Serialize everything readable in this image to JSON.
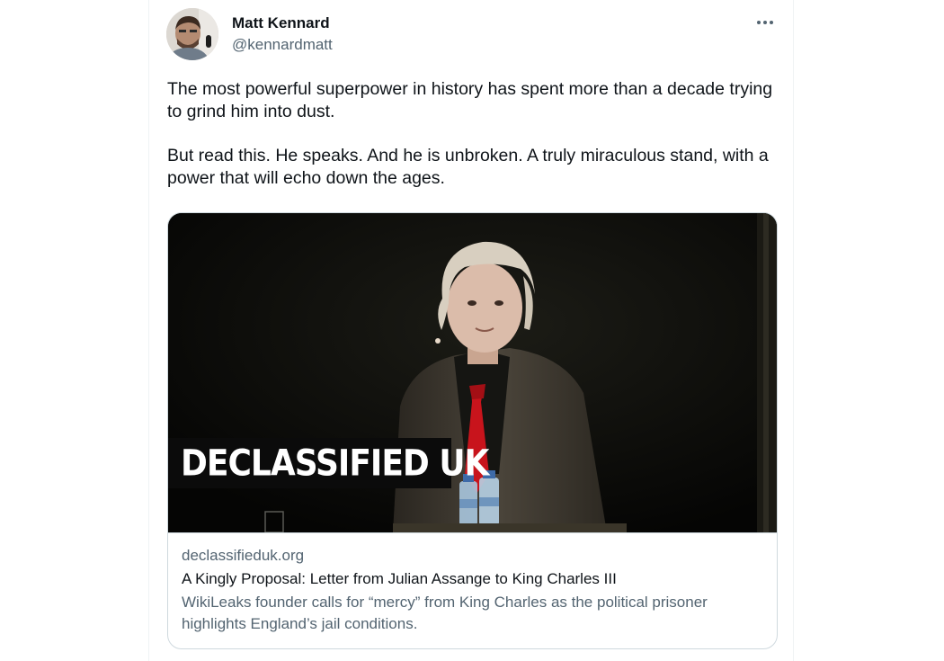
{
  "author": {
    "name": "Matt Kennard",
    "handle": "@kennardmatt"
  },
  "more_icon": "more-horizontal-icon",
  "tweet": {
    "paragraphs": [
      "The most powerful superpower in history has spent more than a decade trying to grind him into dust.",
      "But read this. He speaks. And he is unbroken. A truly miraculous stand, with a power that will echo down the ages."
    ]
  },
  "card": {
    "image_brand_text": "DECLASSIFIED UK",
    "domain": "declassifieduk.org",
    "title": "A Kingly Proposal: Letter from Julian Assange to King Charles III",
    "description": "WikiLeaks founder calls for “mercy” from King Charles as the political prisoner highlights England’s jail conditions."
  },
  "colors": {
    "text_primary": "#0f1419",
    "text_secondary": "#536471",
    "border": "#cfd9de",
    "tie_red": "#c8141c"
  }
}
